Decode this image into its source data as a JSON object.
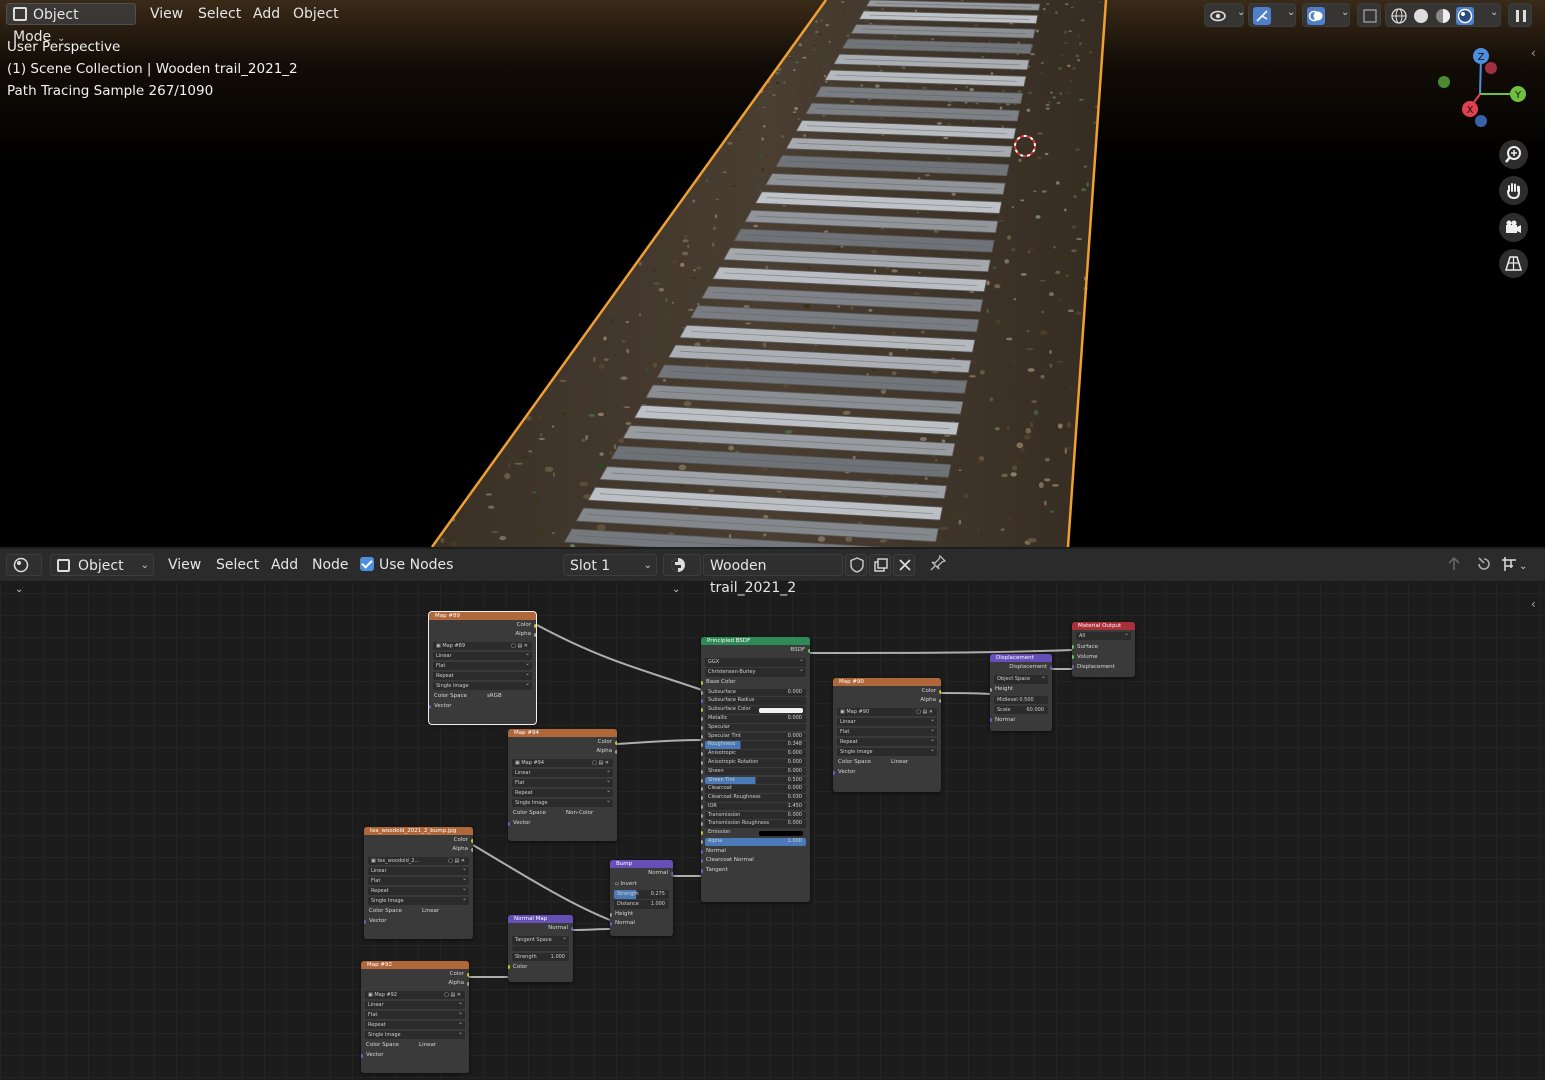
{
  "viewport": {
    "mode_label": "Object Mode",
    "menu": [
      "View",
      "Select",
      "Add",
      "Object"
    ],
    "overlay_lines": [
      "User Perspective",
      "(1) Scene Collection | Wooden trail_2021_2",
      "Path Tracing Sample 267/1090"
    ],
    "gizmo_labels": {
      "z": "Z",
      "y": "Y",
      "x": "X"
    },
    "nav_icons": [
      "zoom-icon",
      "hand-pan-icon",
      "camera-icon",
      "perspective-grid-icon"
    ]
  },
  "node_editor": {
    "type_label": "Object",
    "menu": [
      "View",
      "Select",
      "Add",
      "Node"
    ],
    "use_nodes_label": "Use Nodes",
    "slot_label": "Slot 1",
    "material_name": "Wooden trail_2021_2",
    "nodes": {
      "map89": {
        "title": "Map #89",
        "out1": "Color",
        "out2": "Alpha",
        "image": "Map #89",
        "interp": "Linear",
        "proj": "Flat",
        "ext": "Repeat",
        "src": "Single Image",
        "cs_label": "Color Space",
        "cs_val": "sRGB",
        "vec": "Vector"
      },
      "map94": {
        "title": "Map #94",
        "out1": "Color",
        "out2": "Alpha",
        "image": "Map #94",
        "interp": "Linear",
        "proj": "Flat",
        "ext": "Repeat",
        "src": "Single Image",
        "cs_label": "Color Space",
        "cs_val": "Non-Color",
        "vec": "Vector"
      },
      "bump_tex": {
        "title": "tex_woodold_2021_2_bump.jpg",
        "out1": "Color",
        "out2": "Alpha",
        "image": "tex_woodold_2...",
        "interp": "Linear",
        "proj": "Flat",
        "ext": "Repeat",
        "src": "Single Image",
        "cs_label": "Color Space",
        "cs_val": "Linear",
        "vec": "Vector"
      },
      "map92": {
        "title": "Map #92",
        "out1": "Color",
        "out2": "Alpha",
        "image": "Map #92",
        "interp": "Linear",
        "proj": "Flat",
        "ext": "Repeat",
        "src": "Single Image",
        "cs_label": "Color Space",
        "cs_val": "Linear",
        "vec": "Vector"
      },
      "map90": {
        "title": "Map #90",
        "out1": "Color",
        "out2": "Alpha",
        "image": "Map #90",
        "interp": "Linear",
        "proj": "Flat",
        "ext": "Repeat",
        "src": "Single Image",
        "cs_label": "Color Space",
        "cs_val": "Linear",
        "vec": "Vector"
      },
      "bsdf": {
        "title": "Principled BSDF",
        "out": "BSDF",
        "dist": "GGX",
        "sss": "Christensen-Burley",
        "base_color": "Base Color",
        "params": [
          {
            "label": "Subsurface",
            "value": "0.000"
          },
          {
            "label": "Subsurface Radius",
            "value": ""
          },
          {
            "label": "Subsurface Color",
            "value": ""
          },
          {
            "label": "Metallic",
            "value": "0.000"
          },
          {
            "label": "Specular",
            "value": ""
          },
          {
            "label": "Specular Tint",
            "value": "0.000"
          },
          {
            "label": "Roughness",
            "value": "0.348"
          },
          {
            "label": "Anisotropic",
            "value": "0.000"
          },
          {
            "label": "Anisotropic Rotation",
            "value": "0.000"
          },
          {
            "label": "Sheen",
            "value": "0.000"
          },
          {
            "label": "Sheen Tint",
            "value": "0.500"
          },
          {
            "label": "Clearcoat",
            "value": "0.000"
          },
          {
            "label": "Clearcoat Roughness",
            "value": "0.030"
          },
          {
            "label": "IOR",
            "value": "1.450"
          },
          {
            "label": "Transmission",
            "value": "0.000"
          },
          {
            "label": "Transmission Roughness",
            "value": "0.000"
          },
          {
            "label": "Emission",
            "value": ""
          },
          {
            "label": "Alpha",
            "value": "1.000"
          }
        ],
        "inputs": [
          "Normal",
          "Clearcoat Normal",
          "Tangent"
        ]
      },
      "bump": {
        "title": "Bump",
        "out": "Normal",
        "invert": "Invert",
        "strength_label": "Strength",
        "strength_val": "0.275",
        "distance_label": "Distance",
        "distance_val": "1.000",
        "in1": "Height",
        "in2": "Normal"
      },
      "normal_map": {
        "title": "Normal Map",
        "out": "Normal",
        "space": "Tangent Space",
        "strength_label": "Strength",
        "strength_val": "1.000",
        "in1": "Color"
      },
      "displacement": {
        "title": "Displacement",
        "out": "Displacement",
        "space": "Object Space",
        "in1": "Height",
        "mid_label": "Midlevel",
        "mid_val": "0.500",
        "scale_label": "Scale",
        "scale_val": "60.000",
        "in4": "Normal"
      },
      "output": {
        "title": "Material Output",
        "target": "All",
        "in1": "Surface",
        "in2": "Volume",
        "in3": "Displacement"
      }
    }
  },
  "colors": {
    "selection_outline": "#f0a030",
    "texture_header": "#b0683a",
    "shader_header": "#2e8a56",
    "vector_header": "#6650b8",
    "output_header": "#a8303a"
  }
}
